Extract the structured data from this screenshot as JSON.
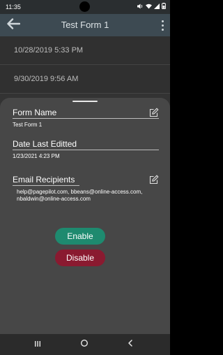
{
  "status_bar": {
    "time": "11:35"
  },
  "app_bar": {
    "title": "Test Form 1"
  },
  "list": {
    "items": [
      {
        "timestamp": "10/28/2019 5:33 PM"
      },
      {
        "timestamp": "9/30/2019  9:56 AM"
      }
    ]
  },
  "sheet": {
    "form_name": {
      "label": "Form Name",
      "value": "Test Form 1"
    },
    "date_last_edited": {
      "label": "Date Last Editted",
      "value": "1/23/2021 4:23 PM"
    },
    "email_recipients": {
      "label": "Email Recipients",
      "value": "help@pagepilot.com, bbeans@online-access.com, nbaldwin@online-access.com"
    },
    "enable_label": "Enable",
    "disable_label": "Disable"
  },
  "colors": {
    "app_bar": "#3d4a52",
    "sheet": "#474747",
    "enable": "#1e8a6f",
    "disable": "#8a1a30"
  },
  "icons": {
    "back": "arrow-left-icon",
    "menu": "more-vertical-icon",
    "edit": "edit-icon",
    "nav_recents": "recents-icon",
    "nav_home": "home-icon",
    "nav_back": "nav-back-icon"
  }
}
